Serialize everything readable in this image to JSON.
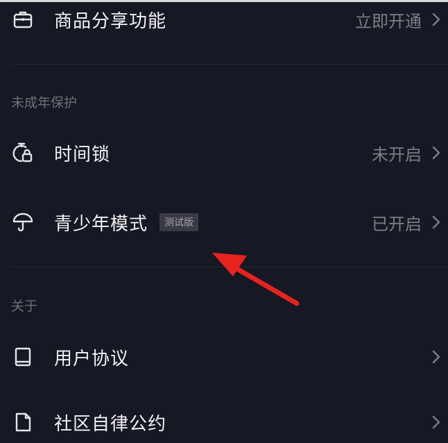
{
  "rows": {
    "share": {
      "label": "商品分享功能",
      "status": "立即开通",
      "icon": "briefcase-icon"
    },
    "timelock": {
      "label": "时间锁",
      "status": "未开启",
      "icon": "timer-lock-icon"
    },
    "teen": {
      "label": "青少年模式",
      "badge": "测试版",
      "status": "已开启",
      "icon": "umbrella-icon"
    },
    "agreement": {
      "label": "用户协议",
      "icon": "book-icon"
    },
    "conventions": {
      "label": "社区自律公约",
      "icon": "document-icon"
    }
  },
  "sections": {
    "minor_protection": "未成年保护",
    "about": "关于"
  },
  "colors": {
    "background": "#161823",
    "annotation_arrow": "#e8231f"
  }
}
